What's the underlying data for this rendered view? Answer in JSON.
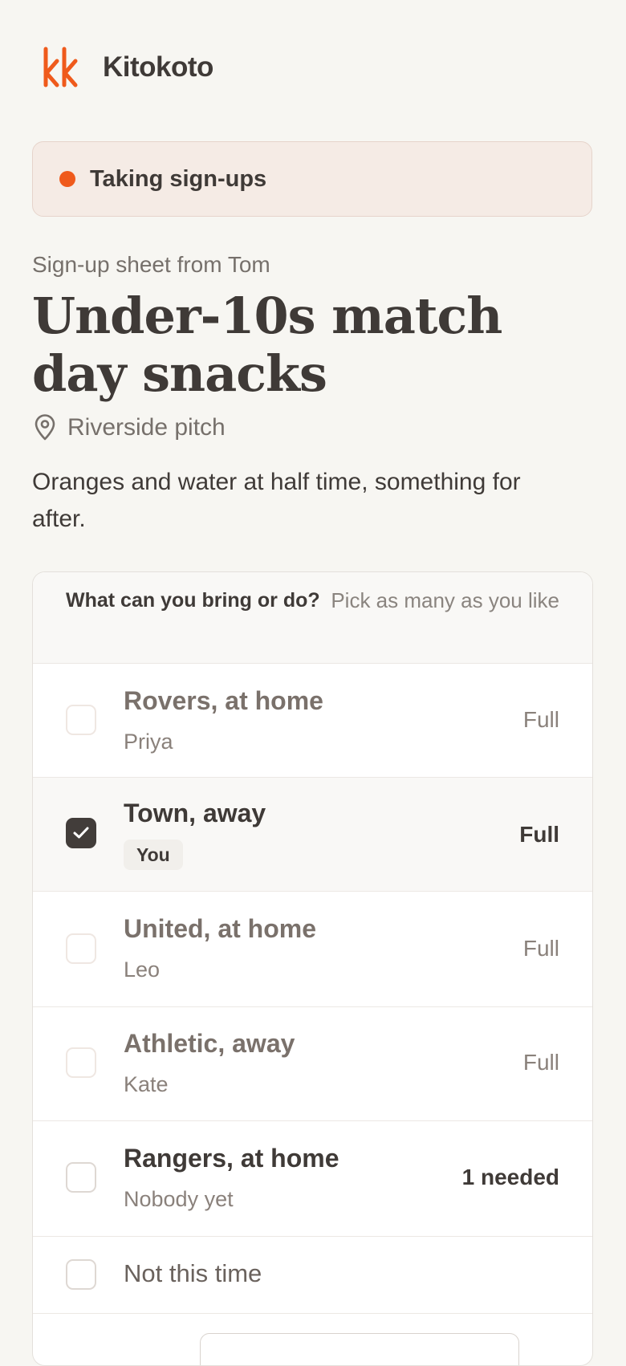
{
  "app": {
    "name": "Kitokoto",
    "logo_text": "kk",
    "accent": "#ef5a1c"
  },
  "banner": {
    "status": "Taking sign-ups",
    "dot_color": "#ef5a1c"
  },
  "sheet": {
    "subtitle": "Sign-up sheet from Tom",
    "title": "Under-10s match day snacks",
    "location": "Riverside pitch",
    "description": "Oranges and water at half time, something for after."
  },
  "card": {
    "question": "What can you bring or do?",
    "hint": "Pick as many as you like",
    "rows": [
      {
        "title": "Rovers, at home",
        "sub": "Priya",
        "status": "Full",
        "checked": false
      },
      {
        "title": "Town, away",
        "badge": "You",
        "status": "Full",
        "checked": true
      },
      {
        "title": "United, at home",
        "sub": "Leo",
        "status": "Full",
        "checked": false
      },
      {
        "title": "Athletic, away",
        "sub": "Kate",
        "status": "Full",
        "checked": false
      },
      {
        "title": "Rangers, at home",
        "sub": "Nobody yet",
        "status": "1 needed",
        "checked": false
      }
    ],
    "decline": "Not this time"
  }
}
